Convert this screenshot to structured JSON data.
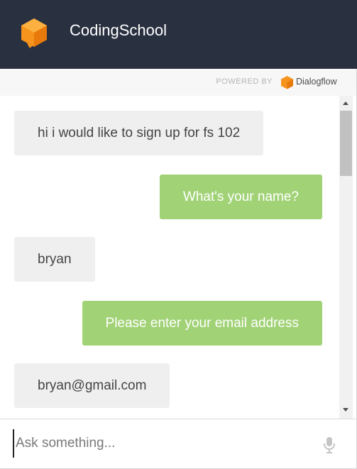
{
  "header": {
    "title": "CodingSchool",
    "logo_icon": "orange-cube-logo"
  },
  "powered_by": {
    "label": "POWERED BY",
    "brand": "Dialogflow",
    "brand_icon": "dialogflow-icon"
  },
  "messages": [
    {
      "sender": "user",
      "text": "hi i would like to sign up for fs 102"
    },
    {
      "sender": "bot",
      "text": "What's your name?"
    },
    {
      "sender": "user",
      "text": "bryan"
    },
    {
      "sender": "bot",
      "text": "Please enter your email address"
    },
    {
      "sender": "user",
      "text": "bryan@gmail.com"
    }
  ],
  "input": {
    "placeholder": "Ask something...",
    "value": ""
  },
  "mic_icon": "microphone-icon",
  "colors": {
    "header_bg": "#293040",
    "bot_bubble": "#a1d276",
    "user_bubble": "#efefef",
    "logo_orange": "#f7941d"
  }
}
